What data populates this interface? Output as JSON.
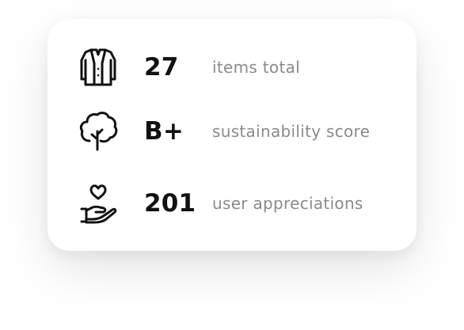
{
  "stats": [
    {
      "icon": "coat-icon",
      "value": "27",
      "label": "items total"
    },
    {
      "icon": "tree-icon",
      "value": "B+",
      "label": "sustainability score"
    },
    {
      "icon": "heart-hand-icon",
      "value": "201",
      "label": "user appreciations"
    }
  ],
  "colors": {
    "card_background": "#ffffff",
    "value_text": "#111111",
    "label_text": "#8a8a8a"
  }
}
